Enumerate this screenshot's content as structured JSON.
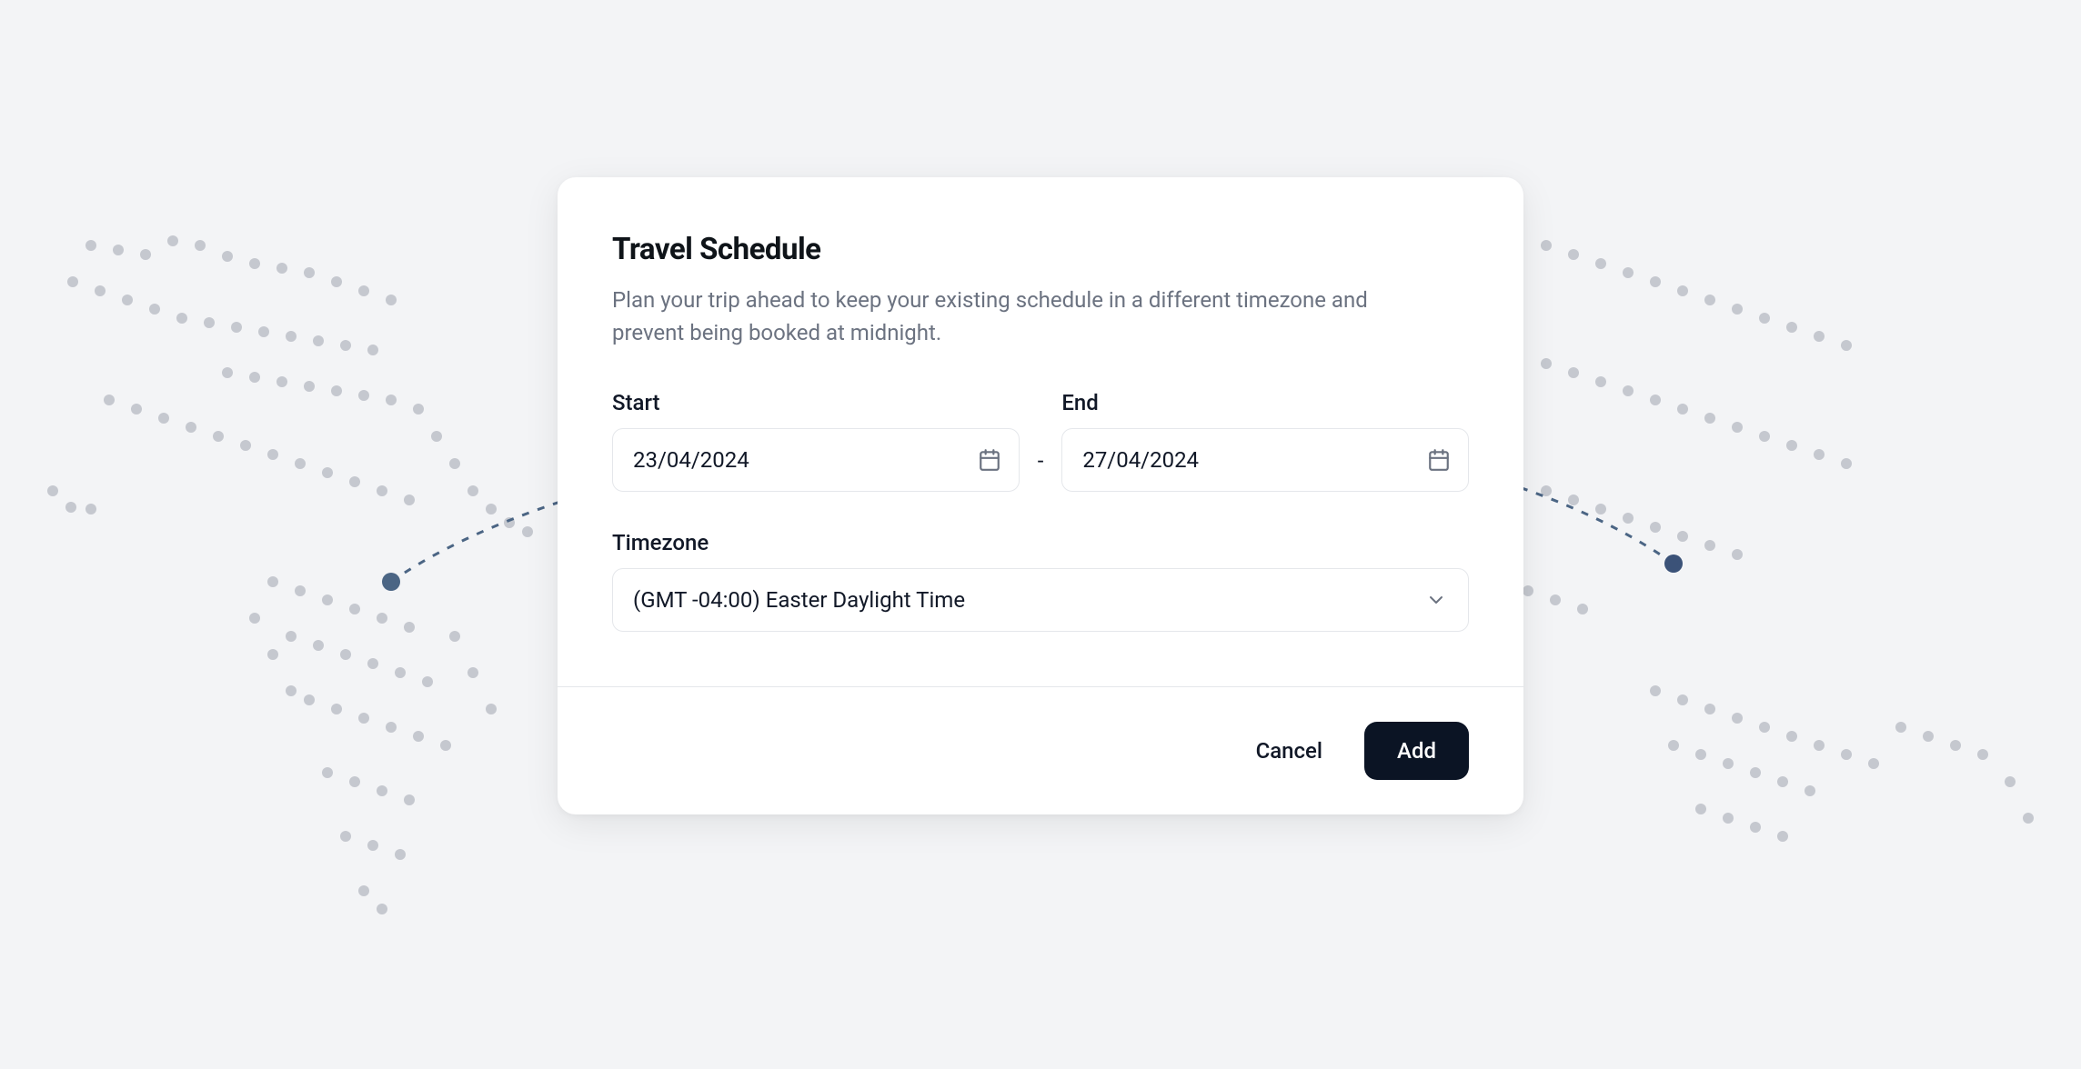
{
  "modal": {
    "title": "Travel Schedule",
    "subtitle": "Plan your trip ahead to keep your existing schedule in a different timezone and prevent being booked at midnight.",
    "start_label": "Start",
    "start_value": "23/04/2024",
    "end_label": "End",
    "end_value": "27/04/2024",
    "separator": "-",
    "timezone_label": "Timezone",
    "timezone_value": "(GMT -04:00) Easter Daylight Time",
    "cancel_label": "Cancel",
    "add_label": "Add"
  }
}
